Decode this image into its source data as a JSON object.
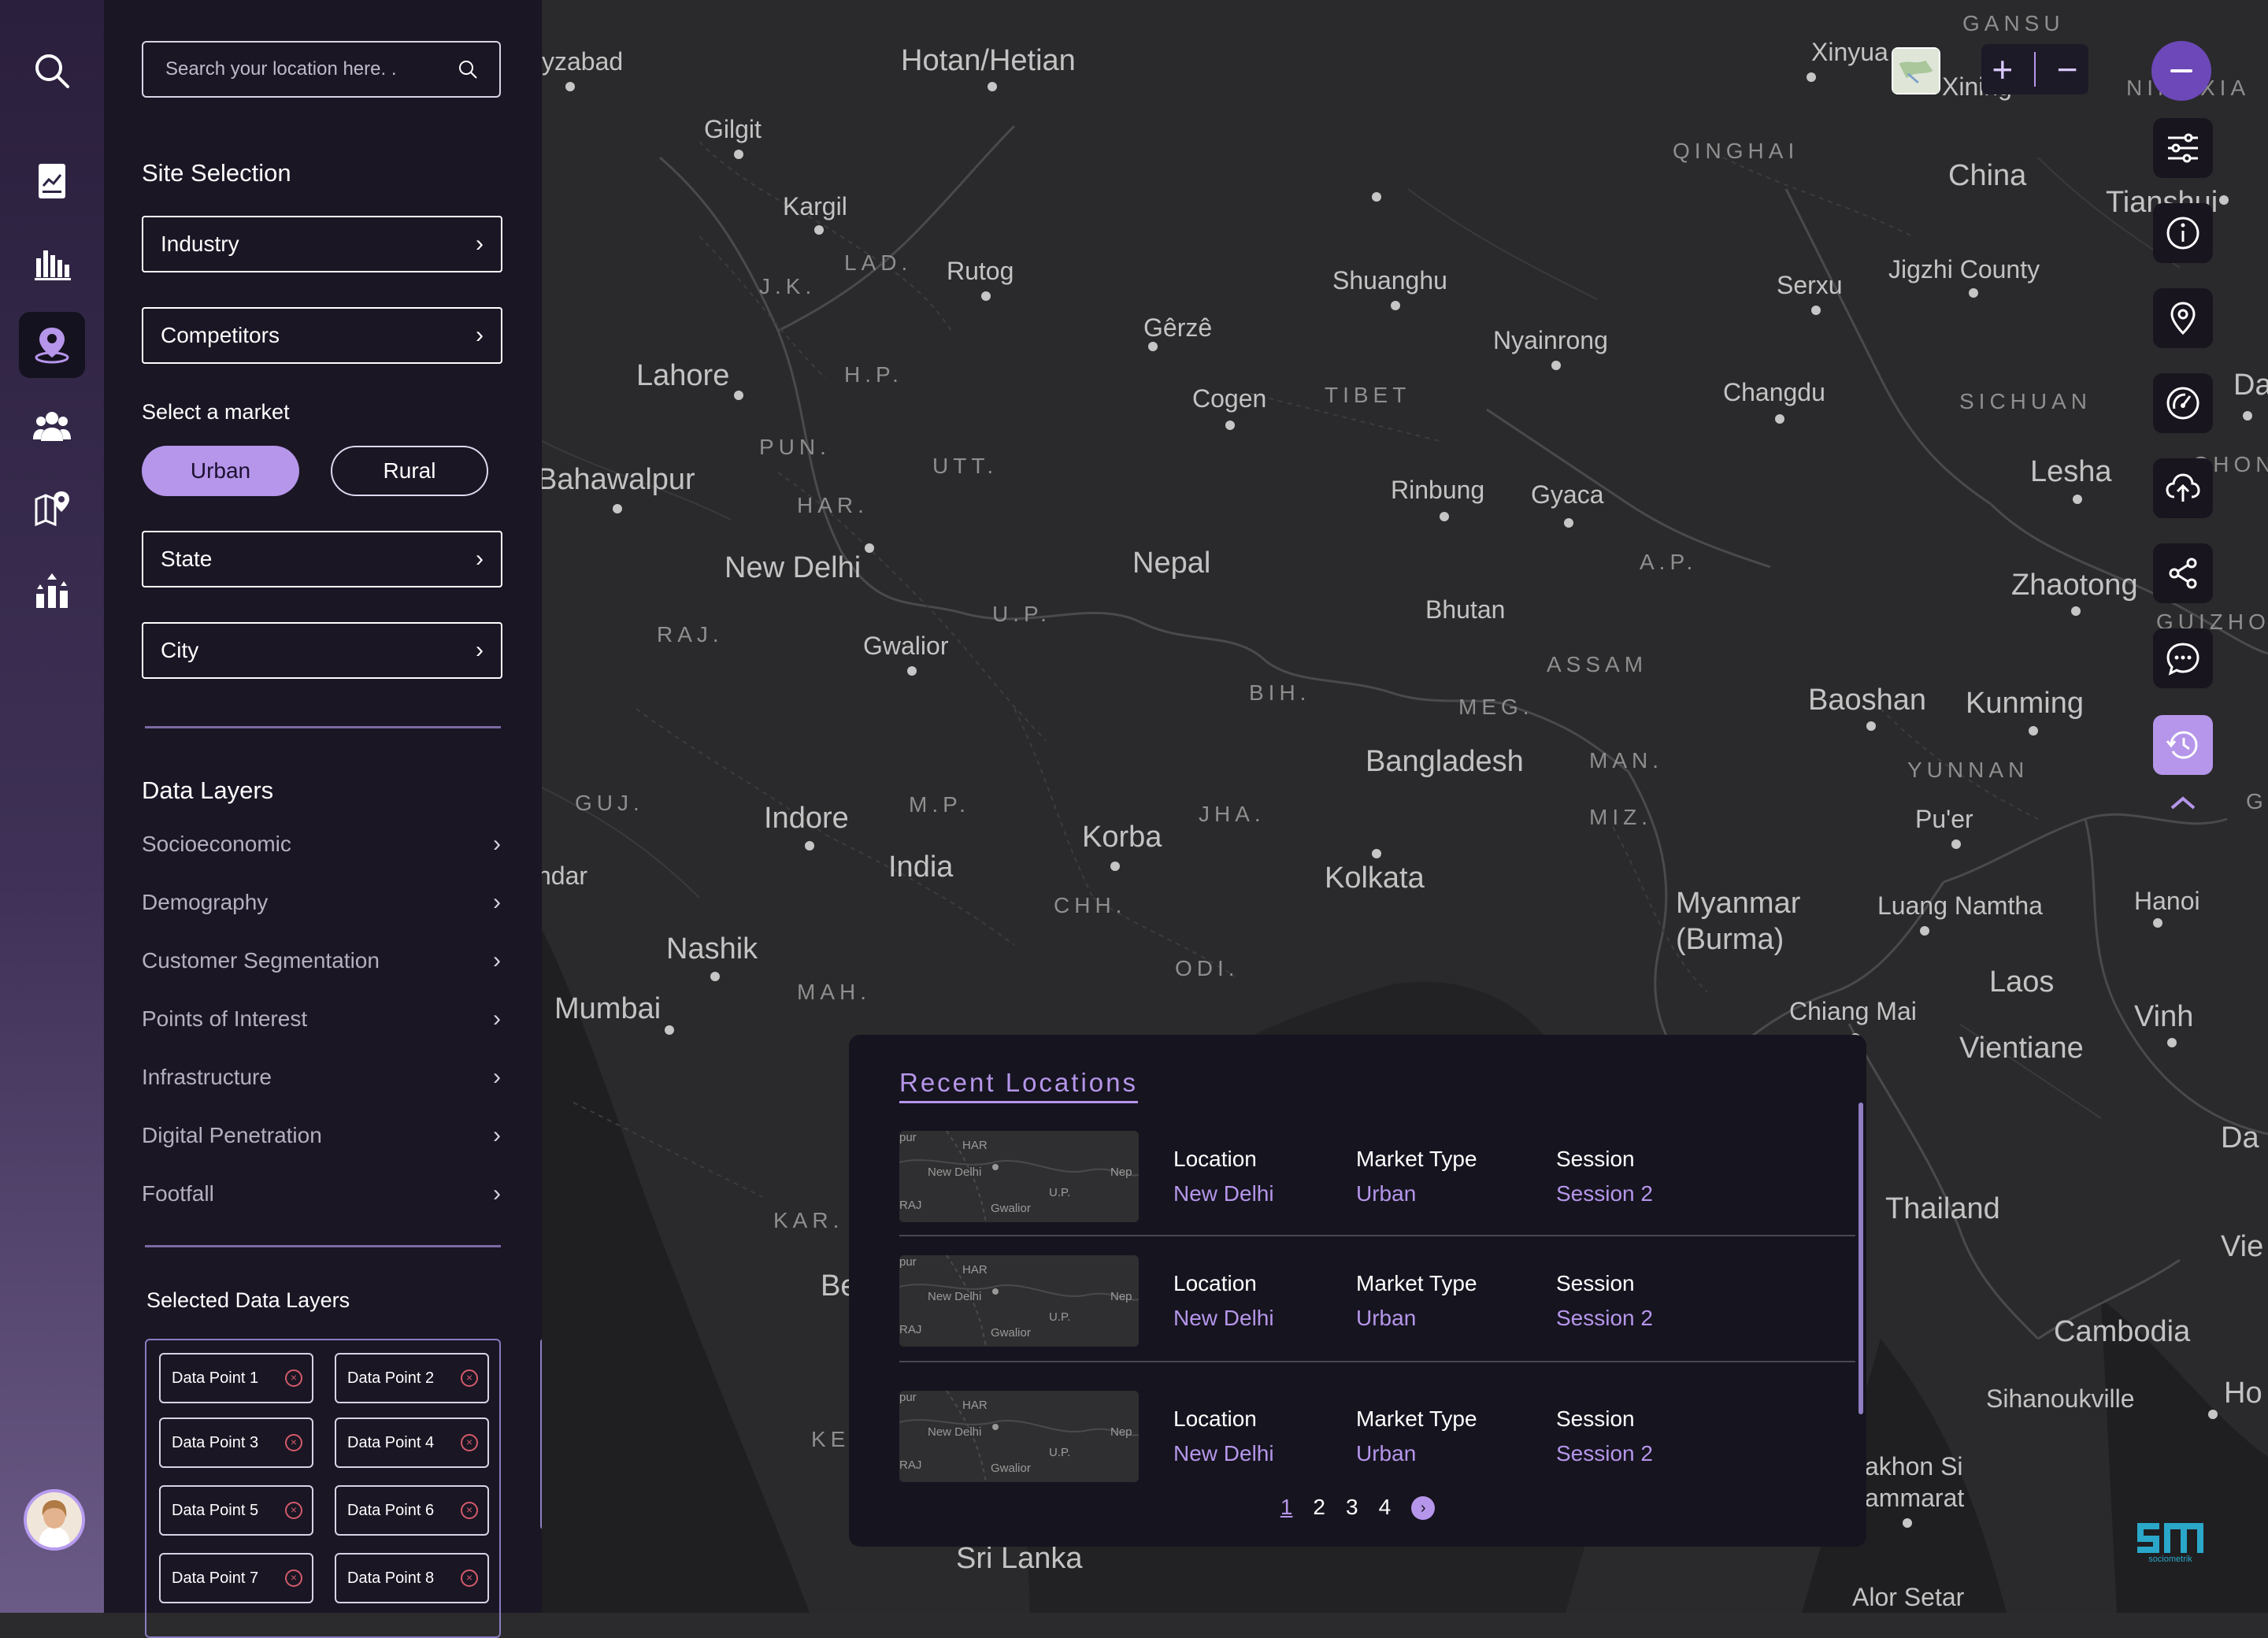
{
  "search": {
    "placeholder": "Search your location here. ."
  },
  "site_selection": {
    "title": "Site Selection",
    "items": [
      {
        "label": "Industry"
      },
      {
        "label": "Competitors"
      }
    ],
    "market_label": "Select a market",
    "market_options": [
      {
        "label": "Urban",
        "selected": true
      },
      {
        "label": "Rural",
        "selected": false
      }
    ],
    "state_label": "State",
    "city_label": "City"
  },
  "data_layers": {
    "title": "Data Layers",
    "items": [
      {
        "label": "Socioeconomic"
      },
      {
        "label": "Demography"
      },
      {
        "label": "Customer Segmentation"
      },
      {
        "label": "Points of Interest"
      },
      {
        "label": "Infrastructure"
      },
      {
        "label": "Digital Penetration"
      },
      {
        "label": "Footfall"
      }
    ]
  },
  "selected_layers": {
    "title": "Selected Data Layers",
    "chips": [
      {
        "label": "Data Point 1"
      },
      {
        "label": "Data Point 2"
      },
      {
        "label": "Data Point 3"
      },
      {
        "label": "Data Point 4"
      },
      {
        "label": "Data Point 5"
      },
      {
        "label": "Data Point 6"
      },
      {
        "label": "Data Point 7"
      },
      {
        "label": "Data Point 8"
      }
    ]
  },
  "map_labels": [
    {
      "text": "yzabad"
    },
    {
      "text": "Hotan/Hetian"
    },
    {
      "text": "Gilgit"
    },
    {
      "text": "Kargil"
    },
    {
      "text": "Rutog"
    },
    {
      "text": "Lahore"
    },
    {
      "text": "Bahawalpur"
    },
    {
      "text": "New Delhi"
    },
    {
      "text": "Gwalior"
    },
    {
      "text": "Indore"
    },
    {
      "text": "India"
    },
    {
      "text": "ndar"
    },
    {
      "text": "Nashik"
    },
    {
      "text": "Mumbai"
    },
    {
      "text": "Korba"
    },
    {
      "text": "Kolkata"
    },
    {
      "text": "Nepal"
    },
    {
      "text": "Gêrzê"
    },
    {
      "text": "Cogen"
    },
    {
      "text": "Shuanghu"
    },
    {
      "text": "Nyainrong"
    },
    {
      "text": "Rinbung"
    },
    {
      "text": "Gyaca"
    },
    {
      "text": "Bhutan"
    },
    {
      "text": "Bangladesh"
    },
    {
      "text": "Xinyua"
    },
    {
      "text": "Xining"
    },
    {
      "text": "China"
    },
    {
      "text": "Jigzhi County"
    },
    {
      "text": "Serxu"
    },
    {
      "text": "Changdu"
    },
    {
      "text": "Tianshui"
    },
    {
      "text": "Lesha"
    },
    {
      "text": "Zhaotong"
    },
    {
      "text": "Baoshan"
    },
    {
      "text": "Kunming"
    },
    {
      "text": "Pu'er"
    },
    {
      "text": "Myanmar (Burma)"
    },
    {
      "text": "Luang Namtha"
    },
    {
      "text": "Hanoi"
    },
    {
      "text": "Laos"
    },
    {
      "text": "Chiang Mai"
    },
    {
      "text": "Vinh"
    },
    {
      "text": "Vientiane"
    },
    {
      "text": "Thailand"
    },
    {
      "text": "Cambodia"
    },
    {
      "text": "Sihanoukville"
    },
    {
      "text": "akhon Si ammarat"
    },
    {
      "text": "Sri Lanka"
    },
    {
      "text": "Alor Setar"
    },
    {
      "text": "Da"
    },
    {
      "text": "Vie"
    },
    {
      "text": "Ho"
    },
    {
      "text": "Be"
    },
    {
      "text": "Dazh"
    }
  ],
  "map_regions": [
    "GANSU",
    "QINGHAI",
    "NINGXIA",
    "LAD.",
    "J.K.",
    "H.P.",
    "PUN.",
    "HAR.",
    "UTT.",
    "RAJ.",
    "U.P.",
    "BIH.",
    "TIBET",
    "SICHUAN",
    "A.P.",
    "ASSAM",
    "MEG.",
    "MAN.",
    "MIZ.",
    "JHA.",
    "GUJ.",
    "M.P.",
    "CHH.",
    "ODI.",
    "MAH.",
    "KAR.",
    "KE",
    "YUNNAN",
    "GUIZHOU",
    "GU",
    "CHONG"
  ],
  "recent": {
    "title": "Recent Locations",
    "rows": [
      {
        "location_label": "Location",
        "location": "New Delhi",
        "market_label": "Market Type",
        "market": "Urban",
        "session_label": "Session",
        "session": "Session 2"
      },
      {
        "location_label": "Location",
        "location": "New Delhi",
        "market_label": "Market Type",
        "market": "Urban",
        "session_label": "Session",
        "session": "Session 2"
      },
      {
        "location_label": "Location",
        "location": "New Delhi",
        "market_label": "Market Type",
        "market": "Urban",
        "session_label": "Session",
        "session": "Session 2"
      }
    ],
    "thumb_labels": [
      "pur",
      "HAR",
      "New Delhi",
      "Nep",
      "U.P.",
      "RAJ",
      "Gwalior"
    ],
    "pages": [
      "1",
      "2",
      "3",
      "4"
    ],
    "current_page": "1"
  },
  "brand": {
    "name": "sociometrik"
  },
  "colors": {
    "accent": "#b596ea",
    "panel": "#1a1624",
    "map": "#2a2a2c"
  }
}
